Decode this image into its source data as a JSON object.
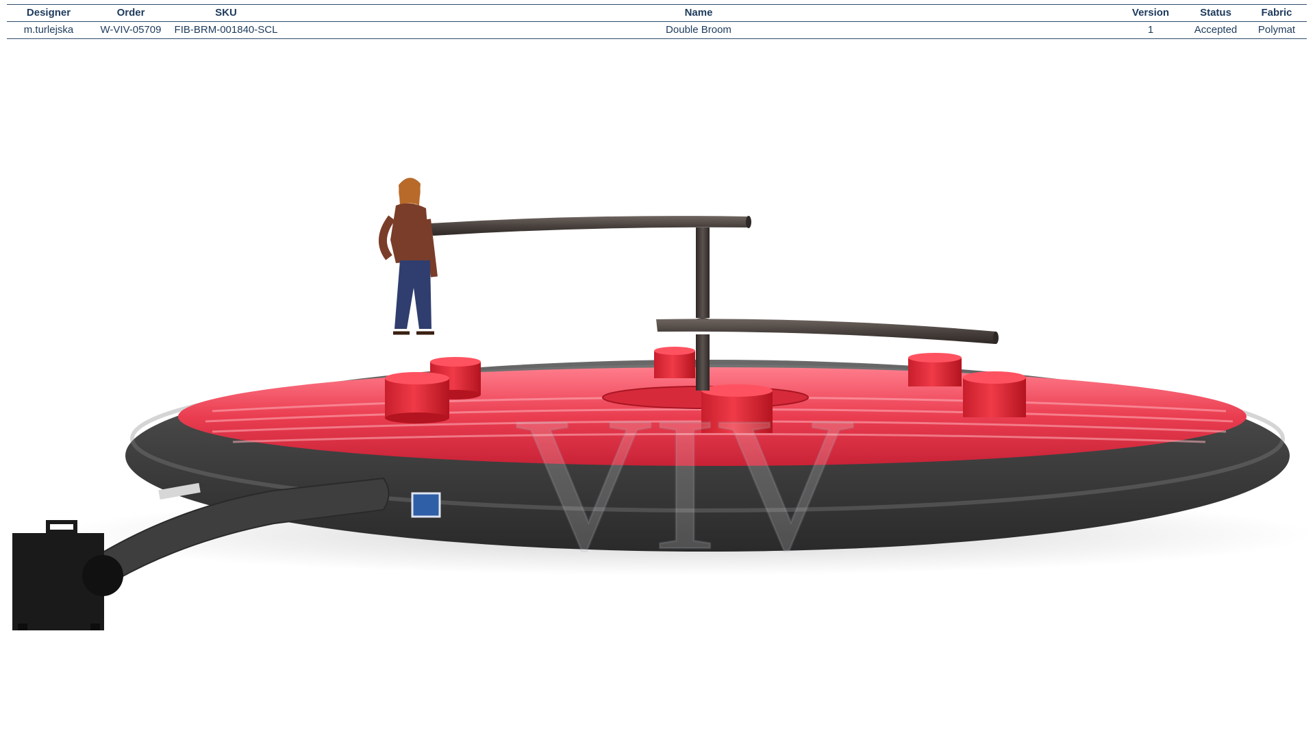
{
  "spec_table": {
    "headers": {
      "designer": "Designer",
      "order": "Order",
      "sku": "SKU",
      "name": "Name",
      "version": "Version",
      "status": "Status",
      "fabric": "Fabric"
    },
    "row": {
      "designer": "m.turlejska",
      "order": "W-VIV-05709",
      "sku": "FIB-BRM-001840-SCL",
      "name": "Double Broom",
      "version": "1",
      "status": "Accepted",
      "fabric": "Polymat"
    }
  },
  "watermark": {
    "text": "VIV"
  },
  "colors": {
    "mat_red": "#e8384a",
    "rim_dark": "#3a3a3a",
    "header_text": "#1d3a5c",
    "blower": "#1a1a1a"
  }
}
